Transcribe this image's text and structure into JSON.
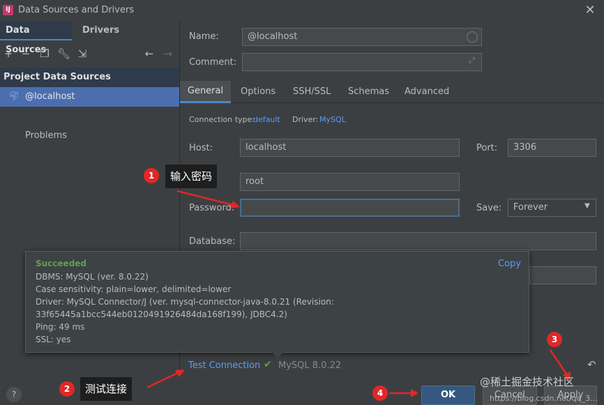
{
  "window": {
    "title": "Data Sources and Drivers",
    "app_icon": "intellij-icon"
  },
  "left": {
    "tabs": [
      "Data Sources",
      "Drivers"
    ],
    "section_header": "Project Data Sources",
    "selected_item": "@localhost",
    "problems": "Problems"
  },
  "form": {
    "name_label": "Name:",
    "name_value": "@localhost",
    "comment_label": "Comment:",
    "comment_value": "",
    "tabs": [
      "General",
      "Options",
      "SSH/SSL",
      "Schemas",
      "Advanced"
    ],
    "connection_type_label": "Connection type:",
    "connection_type_value": "default",
    "driver_label": "Driver:",
    "driver_value": "MySQL",
    "host_label": "Host:",
    "host_value": "localhost",
    "port_label": "Port:",
    "port_value": "3306",
    "user_value": "root",
    "password_label": "Password:",
    "password_value": "",
    "save_label": "Save:",
    "save_value": "Forever",
    "database_label": "Database:",
    "database_value": ""
  },
  "popup": {
    "status": "Succeeded",
    "copy": "Copy",
    "lines": [
      "DBMS: MySQL (ver. 8.0.22)",
      "Case sensitivity: plain=lower, delimited=lower",
      "Driver: MySQL Connector/J (ver. mysql-connector-java-8.0.21 (Revision:",
      "33f65445a1bcc544eb0120491926484da168f199), JDBC4.2)",
      "Ping: 49 ms",
      "SSL: yes"
    ],
    "status_color": "#62a04a"
  },
  "test": {
    "label": "Test Connection",
    "result": "MySQL 8.0.22"
  },
  "buttons": {
    "help": "?",
    "ok": "OK",
    "cancel": "Cancel",
    "apply": "Apply"
  },
  "annotations": {
    "n1": "1",
    "callout1": "输入密码",
    "n2": "2",
    "callout2": "测试连接",
    "n3": "3",
    "n4": "4"
  },
  "watermark": "@稀土掘金技术社区",
  "watermark_url": "https://blog.csdn.net/qq_3..."
}
